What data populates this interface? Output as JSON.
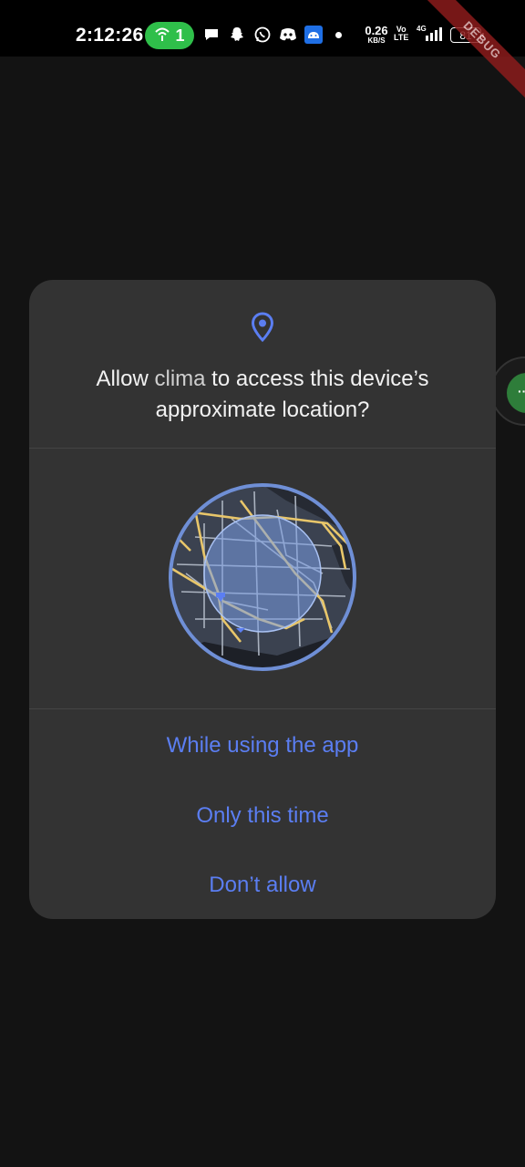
{
  "status_bar": {
    "time": "2:12:26",
    "hotspot_count": "1",
    "net_speed_value": "0.26",
    "net_speed_unit": "KB/S",
    "volte_top": "Vo",
    "volte_bottom": "LTE",
    "network_type": "4G",
    "battery_level": "81",
    "notification_icons": [
      "chat-icon",
      "snapchat-icon",
      "whatsapp-icon",
      "discord-icon",
      "android-icon"
    ]
  },
  "debug_banner": "DEBUG",
  "dialog": {
    "title_prefix": "Allow ",
    "app_name": "clima",
    "title_suffix": " to access this device’s approximate location?",
    "options": [
      {
        "label": "While using the app"
      },
      {
        "label": "Only this time"
      },
      {
        "label": "Don’t allow"
      }
    ]
  },
  "bubble": {
    "label": "··"
  },
  "colors": {
    "accent": "#5b7ef2",
    "dialog_bg": "#333333",
    "screen_bg": "#131313",
    "hotspot": "#2fbf4a",
    "map_road": "#e8c66a",
    "map_circle": "#6f8fd6"
  }
}
